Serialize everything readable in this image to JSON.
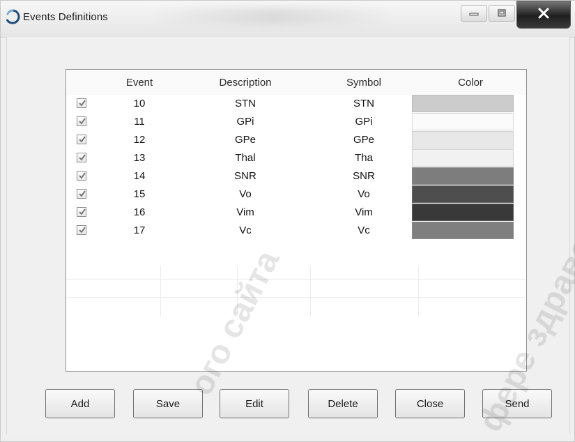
{
  "window": {
    "title": "Events Definitions"
  },
  "table": {
    "headers": {
      "event": "Event",
      "description": "Description",
      "symbol": "Symbol",
      "color": "Color"
    },
    "rows": [
      {
        "checked": true,
        "event": "10",
        "description": "STN",
        "symbol": "STN",
        "color": "#c7c7c7"
      },
      {
        "checked": true,
        "event": "11",
        "description": "GPi",
        "symbol": "GPi",
        "color": "#fbfbfb"
      },
      {
        "checked": true,
        "event": "12",
        "description": "GPe",
        "symbol": "GPe",
        "color": "#e6e6e6"
      },
      {
        "checked": true,
        "event": "13",
        "description": "Thal",
        "symbol": "Tha",
        "color": "#f0f0f0"
      },
      {
        "checked": true,
        "event": "14",
        "description": "SNR",
        "symbol": "SNR",
        "color": "#6f6f6f"
      },
      {
        "checked": true,
        "event": "15",
        "description": "Vo",
        "symbol": "Vo",
        "color": "#3b3b3b"
      },
      {
        "checked": true,
        "event": "16",
        "description": "Vim",
        "symbol": "Vim",
        "color": "#242424"
      },
      {
        "checked": true,
        "event": "17",
        "description": "Vc",
        "symbol": "Vc",
        "color": "#727272"
      }
    ]
  },
  "buttons": {
    "add": "Add",
    "save": "Save",
    "edit": "Edit",
    "delete": "Delete",
    "close": "Close",
    "send": "Send"
  },
  "watermark": {
    "left": "ого сайта",
    "right": "фере здраво"
  },
  "icons": {
    "app": "spinner-icon",
    "minimize": "minimize-icon",
    "maximize": "maximize-icon",
    "close": "close-icon",
    "checkbox": "checkmark-icon"
  }
}
